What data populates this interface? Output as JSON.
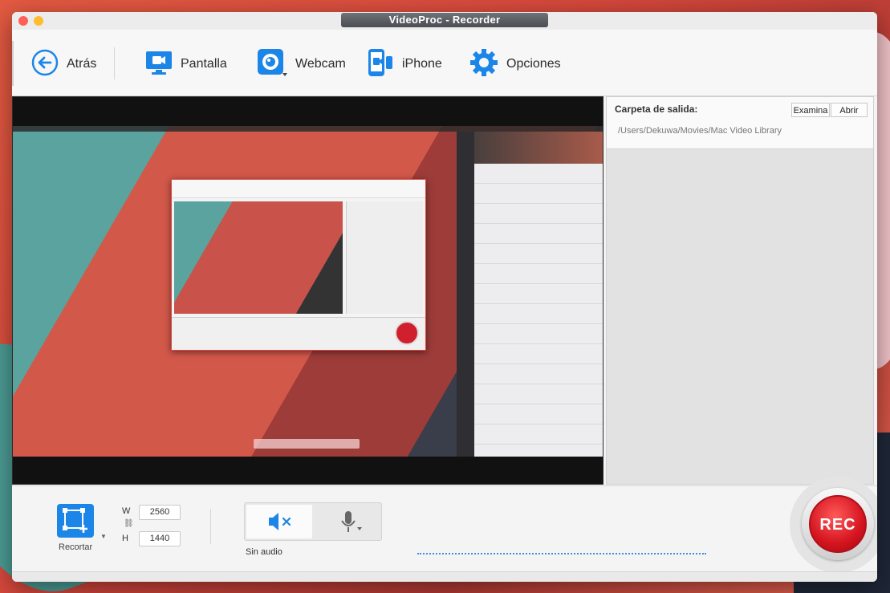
{
  "window": {
    "title": "VideoProc - Recorder"
  },
  "toolbar": {
    "back_label": "Atrás",
    "screen_label": "Pantalla",
    "webcam_label": "Webcam",
    "iphone_label": "iPhone",
    "options_label": "Opciones"
  },
  "output": {
    "title": "Carpeta de salida:",
    "browse_label": "Examina",
    "open_label": "Abrir",
    "path": "/Users/Dekuwa/Movies/Mac Video Library"
  },
  "crop": {
    "label": "Recortar",
    "width_label": "W",
    "height_label": "H",
    "width_value": "2560",
    "height_value": "1440"
  },
  "audio": {
    "status_label": "Sin audio"
  },
  "rec": {
    "label": "REC"
  },
  "colors": {
    "accent": "#1c86e8",
    "rec": "#d4141f"
  }
}
